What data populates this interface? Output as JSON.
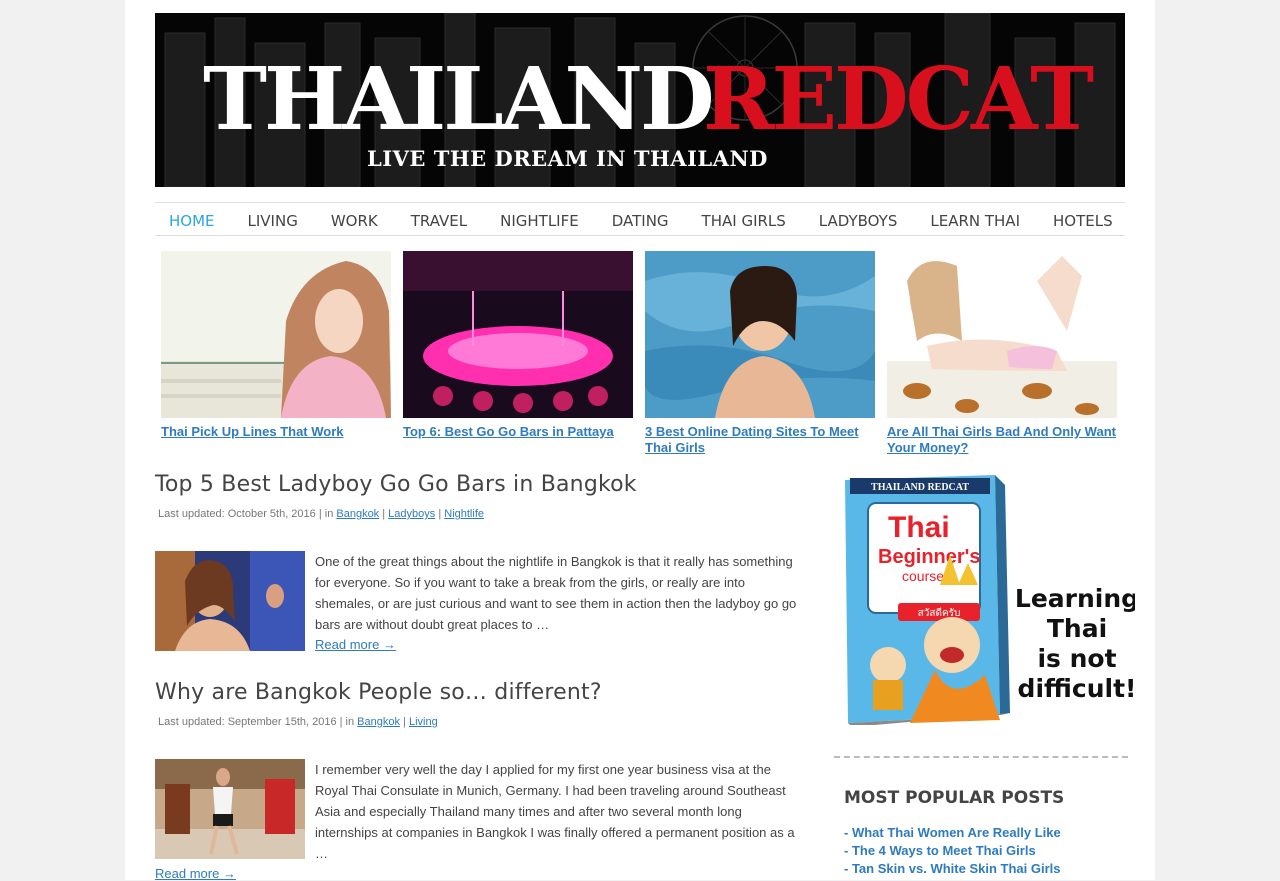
{
  "header": {
    "logo_part1": "THAILAND",
    "logo_part2": "REDCAT",
    "tagline": "LIVE THE DREAM IN THAILAND"
  },
  "nav": {
    "items": [
      {
        "label": "HOME",
        "active": true
      },
      {
        "label": "LIVING"
      },
      {
        "label": "WORK"
      },
      {
        "label": "TRAVEL"
      },
      {
        "label": "NIGHTLIFE"
      },
      {
        "label": "DATING"
      },
      {
        "label": "THAI GIRLS"
      },
      {
        "label": "LADYBOYS"
      },
      {
        "label": "LEARN THAI"
      },
      {
        "label": "HOTELS"
      }
    ]
  },
  "featured": [
    {
      "caption": "Thai Pick Up Lines That Work"
    },
    {
      "caption": "Top 6: Best Go Go Bars in Pattaya"
    },
    {
      "caption": "3 Best Online Dating Sites To Meet Thai Girls"
    },
    {
      "caption": "Are All Thai Girls Bad And Only Want Your Money?"
    }
  ],
  "posts": [
    {
      "title": "Top 5 Best Ladyboy Go Go Bars in Bangkok",
      "meta_prefix": "Last updated: October 5th, 2016 | in ",
      "categories": [
        "Bangkok",
        "Ladyboys",
        "Nightlife"
      ],
      "excerpt": "One of the great things about the nightlife in Bangkok is that it really has something for everyone. So if you want to take a break from the girls, or really are into shemales, or are just curious and want to see them in action then the ladyboy go go bars are without doubt great places to …",
      "read_more": "Read more →"
    },
    {
      "title": "Why are Bangkok People so… different?",
      "meta_prefix": "Last updated: September 15th, 2016 | in ",
      "categories": [
        "Bangkok",
        "Living"
      ],
      "excerpt": "I remember very well the day I applied for my first one year business visa at the Royal Thai Consulate in Munich, Germany. I had been traveling around Southeast Asia and especially Thailand many times and after two several month long internships at companies in Bangkok I was finally offered a permanent position as a …",
      "read_more": "Read more →"
    }
  ],
  "sidebar": {
    "ad": {
      "brand": "THAILAND REDCAT",
      "book_title_1": "Thai",
      "book_title_2": "Beginner's",
      "book_title_3": "course",
      "book_thai": "สวัสดีครับ",
      "slogan_1": "Learning",
      "slogan_2": "Thai",
      "slogan_3": "is not",
      "slogan_4": "difficult!"
    },
    "popular_heading": "MOST POPULAR POSTS",
    "popular": [
      "- What Thai Women Are Really Like",
      "- The 4 Ways to Meet Thai Girls",
      "- Tan Skin vs. White Skin Thai Girls"
    ]
  }
}
